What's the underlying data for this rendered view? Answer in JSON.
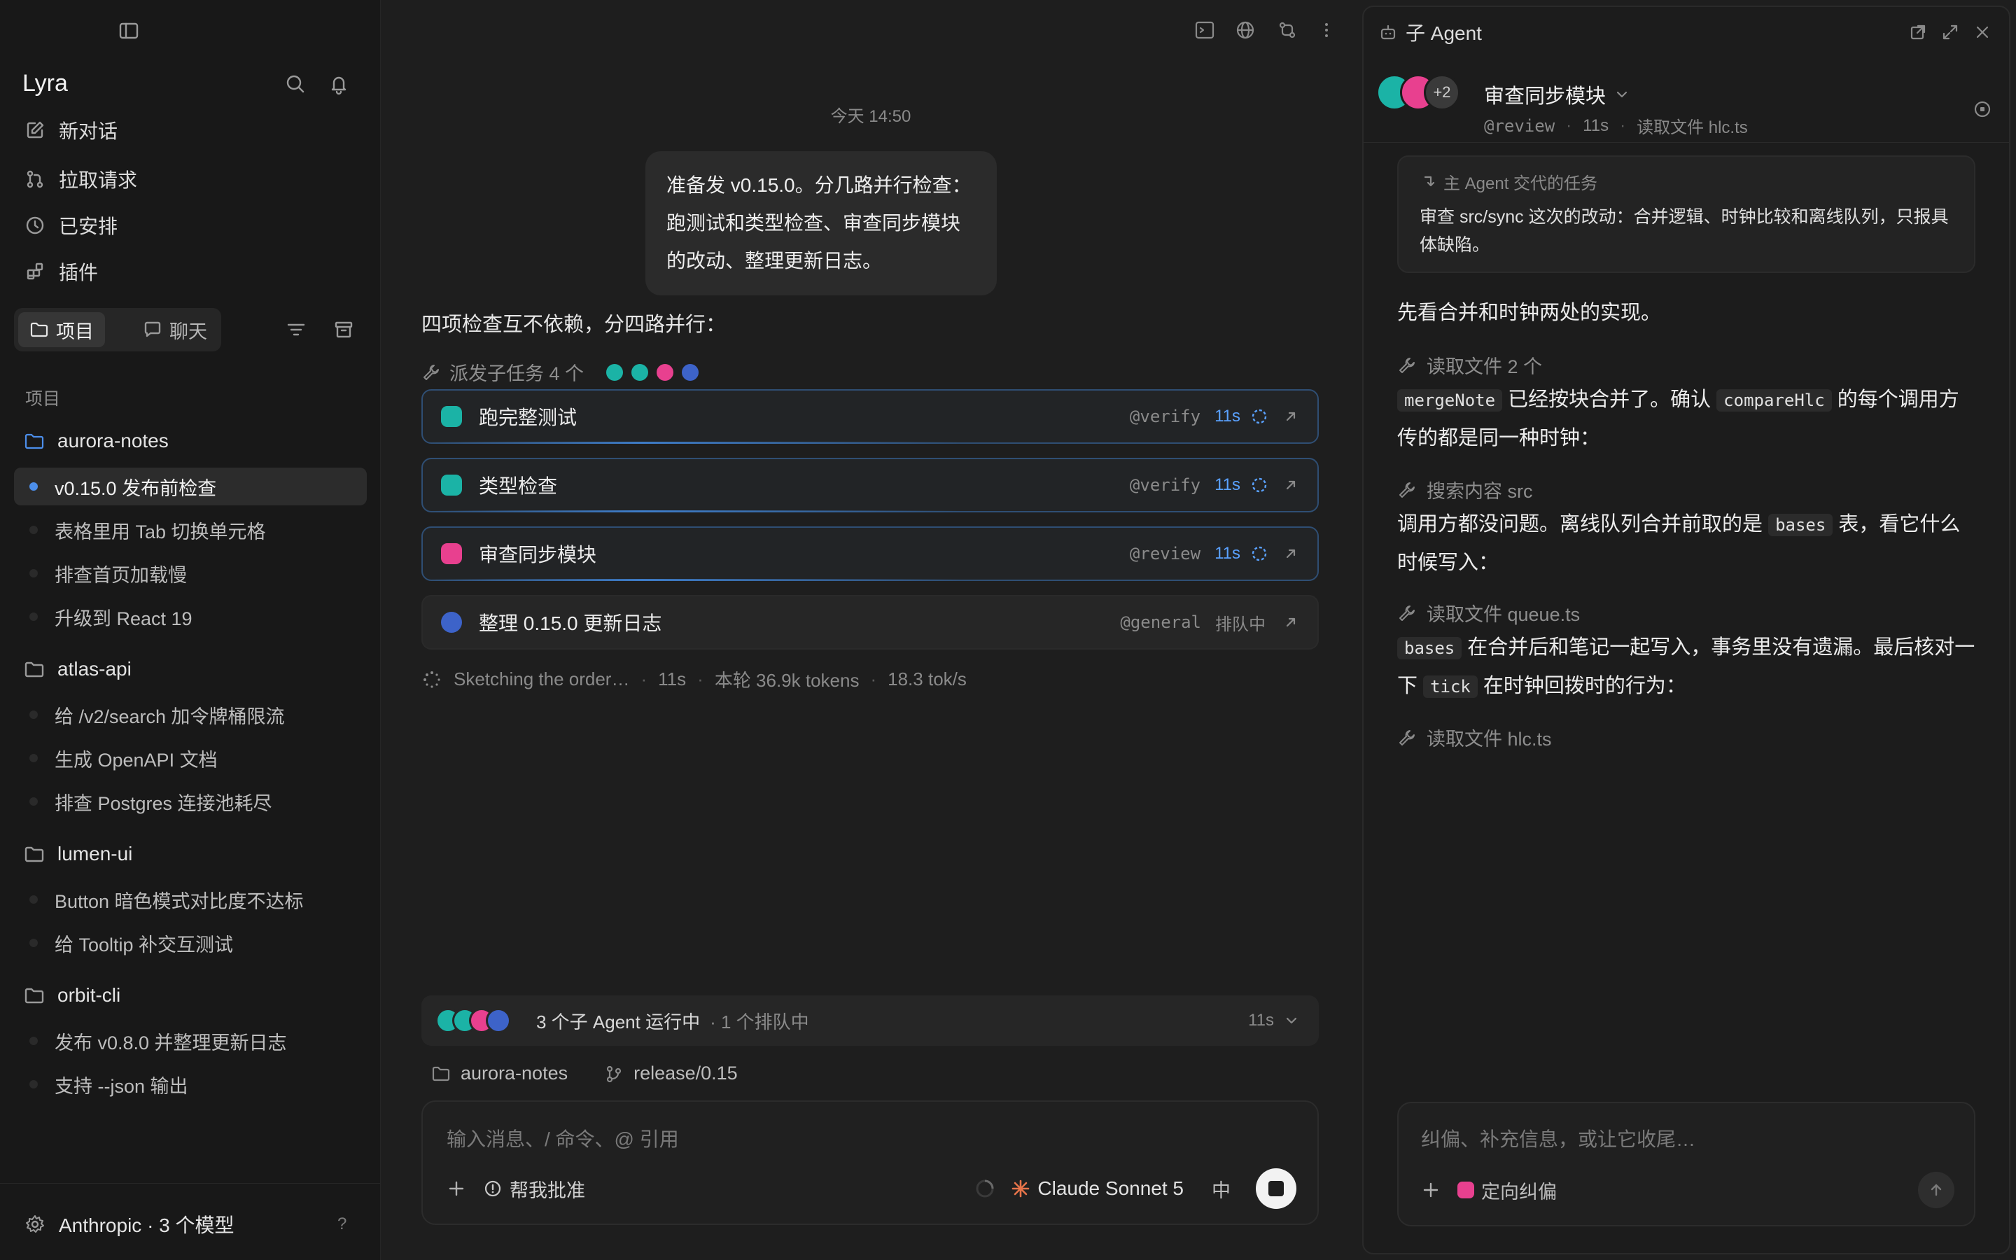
{
  "sidebar": {
    "app_title": "Lyra",
    "nav": [
      {
        "label": "新对话",
        "icon": "edit-icon"
      },
      {
        "label": "拉取请求",
        "icon": "pull-request-icon"
      },
      {
        "label": "已安排",
        "icon": "clock-icon"
      },
      {
        "label": "插件",
        "icon": "plugin-icon"
      }
    ],
    "segment": {
      "projects": "项目",
      "chats": "聊天"
    },
    "section_label": "项目",
    "projects": [
      {
        "name": "aurora-notes",
        "threads": [
          "v0.15.0 发布前检查",
          "表格里用 Tab 切换单元格",
          "排查首页加载慢",
          "升级到 React 19"
        ]
      },
      {
        "name": "atlas-api",
        "threads": [
          "给 /v2/search 加令牌桶限流",
          "生成 OpenAPI 文档",
          "排查 Postgres 连接池耗尽"
        ]
      },
      {
        "name": "lumen-ui",
        "threads": [
          "Button 暗色模式对比度不达标",
          "给 Tooltip 补交互测试"
        ]
      },
      {
        "name": "orbit-cli",
        "threads": [
          "发布 v0.8.0 并整理更新日志",
          "支持 --json 输出"
        ]
      }
    ],
    "footer": {
      "label": "Anthropic · 3 个模型",
      "help": "?"
    }
  },
  "main": {
    "timestamp": "今天 14:50",
    "user_message": "准备发 v0.15.0。分几路并行检查：跑测试和类型检查、审查同步模块的改动、整理更新日志。",
    "assistant_intro": "四项检查互不依赖，分四路并行：",
    "dispatch_label": "派发子任务 4 个",
    "tasks": [
      {
        "title": "跑完整测试",
        "tag": "@verify",
        "time": "11s",
        "status": "running",
        "color": "#1bb3a6"
      },
      {
        "title": "类型检查",
        "tag": "@verify",
        "time": "11s",
        "status": "running",
        "color": "#1bb3a6"
      },
      {
        "title": "审查同步模块",
        "tag": "@review",
        "time": "11s",
        "status": "running",
        "color": "#e8408f"
      },
      {
        "title": "整理 0.15.0 更新日志",
        "tag": "@general",
        "time": "排队中",
        "status": "queued",
        "color": "#3d63c9"
      }
    ],
    "status": {
      "text": "Sketching the order…",
      "elapsed": "11s",
      "tokens": "本轮 36.9k tokens",
      "rate": "18.3 tok/s"
    },
    "agents_bar": {
      "running": "3 个子 Agent 运行中",
      "queued": "· 1 个排队中",
      "time": "11s"
    },
    "context": {
      "project": "aurora-notes",
      "branch": "release/0.15"
    },
    "composer": {
      "placeholder": "输入消息、/ 命令、@ 引用",
      "approve": "帮我批准",
      "model": "Claude Sonnet 5",
      "lang": "中"
    }
  },
  "panel": {
    "title": "子 Agent",
    "task_title": "审查同步模块",
    "meta_tag": "@review",
    "meta_time": "11s",
    "meta_action": "读取文件 hlc.ts",
    "extra_count": "+2",
    "handoff_label": "主 Agent 交代的任务",
    "handoff_text": "审查 src/sync 这次的改动：合并逻辑、时钟比较和离线队列，只报具体缺陷。",
    "p1": "先看合并和时钟两处的实现。",
    "tool1": "读取文件 2 个",
    "p2_code1": "mergeNote",
    "p2_a": " 已经按块合并了。确认 ",
    "p2_code2": "compareHlc",
    "p2_b": " 的每个调用方传的都是同一种时钟：",
    "tool2": "搜索内容 src",
    "p3_a": "调用方都没问题。离线队列合并前取的是 ",
    "p3_code": "bases",
    "p3_b": " 表，看它什么时候写入：",
    "tool3": "读取文件 queue.ts",
    "p4_code1": "bases",
    "p4_a": " 在合并后和笔记一起写入，事务里没有遗漏。最后核对一下 ",
    "p4_code2": "tick",
    "p4_b": " 在时钟回拨时的行为：",
    "tool4": "读取文件 hlc.ts",
    "composer_placeholder": "纠偏、补充信息，或让它收尾…",
    "steer_label": "定向纠偏"
  },
  "colors": {
    "teal": "#1bb3a6",
    "pink": "#e8408f",
    "blue": "#3d63c9",
    "accent": "#5aa1ff"
  }
}
